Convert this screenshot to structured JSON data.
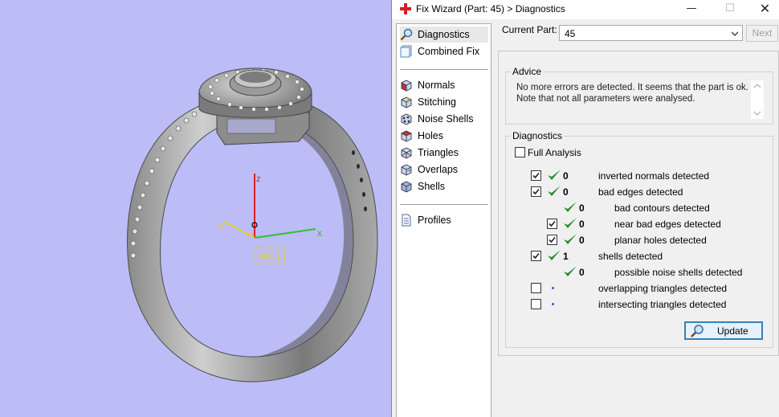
{
  "viewport": {
    "axis_x": "x",
    "axis_y": "y",
    "axis_z": "z",
    "wcs_label": "WCS",
    "colors": {
      "background": "#bcbcf7",
      "x_axis": "#2ec22e",
      "y_axis": "#e0d020",
      "z_axis": "#e02020"
    }
  },
  "window": {
    "title": "Fix Wizard (Part: 45) > Diagnostics",
    "minimize": "—",
    "maximize": "☐",
    "close": "✕"
  },
  "nav": {
    "top_items": [
      {
        "label": "Diagnostics",
        "icon": "magnifier-icon",
        "selected": true
      },
      {
        "label": "Combined Fix",
        "icon": "combined-fix-icon"
      }
    ],
    "tool_items": [
      {
        "label": "Normals",
        "icon": "normals-cube-icon"
      },
      {
        "label": "Stitching",
        "icon": "stitching-cube-icon"
      },
      {
        "label": "Noise Shells",
        "icon": "noise-shells-icon"
      },
      {
        "label": "Holes",
        "icon": "holes-cube-icon"
      },
      {
        "label": "Triangles",
        "icon": "triangles-cube-icon"
      },
      {
        "label": "Overlaps",
        "icon": "overlaps-cube-icon"
      },
      {
        "label": "Shells",
        "icon": "shells-cube-icon"
      }
    ],
    "bottom_items": [
      {
        "label": "Profiles",
        "icon": "document-icon"
      }
    ]
  },
  "current_part": {
    "label": "Current Part:",
    "value": "45",
    "next_label": "Next"
  },
  "advice": {
    "title": "Advice",
    "line1": "No more errors are detected. It seems that the part is ok.",
    "line2": "Note that not all parameters were analysed."
  },
  "diagnostics": {
    "title": "Diagnostics",
    "full_analysis_label": "Full Analysis",
    "full_analysis_checked": false,
    "rows": [
      {
        "checkbox": true,
        "checked": true,
        "status": "ok",
        "count": "0",
        "label": "inverted normals detected",
        "indent": 0
      },
      {
        "checkbox": true,
        "checked": true,
        "status": "ok",
        "count": "0",
        "label": "bad edges detected",
        "indent": 0
      },
      {
        "checkbox": false,
        "checked": false,
        "status": "ok",
        "count": "0",
        "label": "bad contours detected",
        "indent": 1
      },
      {
        "checkbox": true,
        "checked": true,
        "status": "ok",
        "count": "0",
        "label": "near bad edges detected",
        "indent": 1
      },
      {
        "checkbox": true,
        "checked": true,
        "status": "ok",
        "count": "0",
        "label": "planar holes detected",
        "indent": 1
      },
      {
        "checkbox": true,
        "checked": true,
        "status": "ok",
        "count": "1",
        "label": "shells detected",
        "indent": 0
      },
      {
        "checkbox": false,
        "checked": false,
        "status": "ok",
        "count": "0",
        "label": "possible noise shells detected",
        "indent": 1
      },
      {
        "checkbox": true,
        "checked": false,
        "status": "pending",
        "count": "",
        "label": "overlapping triangles detected",
        "indent": 0
      },
      {
        "checkbox": true,
        "checked": false,
        "status": "pending",
        "count": "",
        "label": "intersecting triangles detected",
        "indent": 0
      }
    ],
    "update_label": "Update"
  }
}
